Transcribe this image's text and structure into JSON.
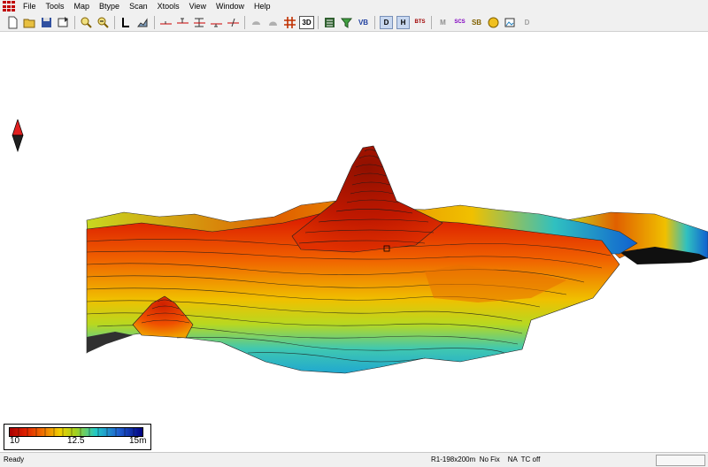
{
  "menu": {
    "items": [
      "File",
      "Tools",
      "Map",
      "Btype",
      "Scan",
      "Xtools",
      "View",
      "Window",
      "Help"
    ]
  },
  "toolbar": {
    "icons": [
      "new-file",
      "open-folder",
      "save",
      "import",
      "zoom-in",
      "zoom-out",
      "line",
      "profile",
      "cross-section-1",
      "cross-section-2",
      "cross-section-3",
      "cross-section-4",
      "cross-section-5",
      "blob-1",
      "blob-2",
      "grid-hash",
      "3d-view",
      "list",
      "layer-filter",
      "vb",
      "d-mode",
      "h-mode",
      "bts",
      "m-tool",
      "scs",
      "sb",
      "circle-tool",
      "image-tool",
      "d-tool"
    ],
    "label_3d": "3D",
    "label_d": "D",
    "label_h": "H",
    "label_bts": "BTS",
    "label_scs": "SCS",
    "label_sb": "SB",
    "label_m": "M",
    "label_vb": "VB"
  },
  "colors": {
    "deep": "#a80000",
    "red": "#e02000",
    "orange": "#f07000",
    "yellow": "#f0d000",
    "lime": "#a0d020",
    "cyan": "#20c8c8",
    "blue": "#2060d0",
    "navy": "#000080"
  },
  "legend": {
    "min_label": "10",
    "mid_label": "12.5",
    "max_label": "15m"
  },
  "status": {
    "left": "Ready",
    "right": "R1-198x200m  No Fix    NA  TC off"
  }
}
